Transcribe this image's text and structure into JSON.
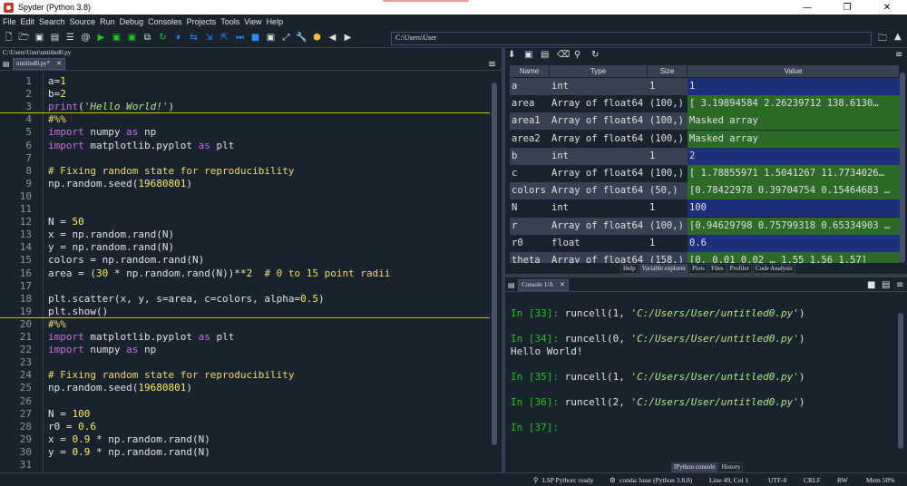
{
  "window": {
    "title": "Spyder (Python 3.8)",
    "min": "—",
    "max": "❐",
    "close": "✕"
  },
  "menu": [
    "File",
    "Edit",
    "Search",
    "Source",
    "Run",
    "Debug",
    "Consoles",
    "Projects",
    "Tools",
    "View",
    "Help"
  ],
  "toolbar": {
    "path": "C:\\Users\\User"
  },
  "editor": {
    "file_path": "C:\\Users\\User\\untitled0.py",
    "tab_label": "untitled0.py*",
    "lines": [
      {
        "n": "1",
        "html": "a=<span class=\"num\">1</span>"
      },
      {
        "n": "2",
        "html": "b=<span class=\"num\">2</span>"
      },
      {
        "n": "3",
        "html": "<span class=\"kw\">print</span>(<span class=\"str\">'Hello World!'</span>)",
        "sep": true
      },
      {
        "n": "4",
        "html": "<span class=\"cmt\">#%%</span>"
      },
      {
        "n": "5",
        "html": "<span class=\"kw\">import</span> numpy <span class=\"kw\">as</span> np"
      },
      {
        "n": "6",
        "html": "<span class=\"kw\">import</span> matplotlib.pyplot <span class=\"kw\">as</span> plt"
      },
      {
        "n": "7",
        "html": ""
      },
      {
        "n": "8",
        "html": "<span class=\"cmt\"># Fixing random state for reproducibility</span>"
      },
      {
        "n": "9",
        "html": "np.random.seed(<span class=\"num\">19680801</span>)"
      },
      {
        "n": "10",
        "html": ""
      },
      {
        "n": "11",
        "html": ""
      },
      {
        "n": "12",
        "html": "N = <span class=\"num\">50</span>"
      },
      {
        "n": "13",
        "html": "x = np.random.rand(N)"
      },
      {
        "n": "14",
        "html": "y = np.random.rand(N)"
      },
      {
        "n": "15",
        "html": "colors = np.random.rand(N)"
      },
      {
        "n": "16",
        "html": "area = (<span class=\"num\">30</span> * np.random.rand(N))**<span class=\"num\">2</span>  <span class=\"cmt\"># 0 to 15 point radii</span>"
      },
      {
        "n": "17",
        "html": ""
      },
      {
        "n": "18",
        "html": "plt.scatter(x, y, s=area, c=colors, alpha=<span class=\"num\">0.5</span>)"
      },
      {
        "n": "19",
        "html": "plt.show()",
        "sep": true
      },
      {
        "n": "20",
        "html": "<span class=\"cmt\">#%%</span>"
      },
      {
        "n": "21",
        "html": "<span class=\"kw\">import</span> matplotlib.pyplot <span class=\"kw\">as</span> plt"
      },
      {
        "n": "22",
        "html": "<span class=\"kw\">import</span> numpy <span class=\"kw\">as</span> np"
      },
      {
        "n": "23",
        "html": ""
      },
      {
        "n": "24",
        "html": "<span class=\"cmt\"># Fixing random state for reproducibility</span>"
      },
      {
        "n": "25",
        "html": "np.random.seed(<span class=\"num\">19680801</span>)"
      },
      {
        "n": "26",
        "html": ""
      },
      {
        "n": "27",
        "html": "N = <span class=\"num\">100</span>"
      },
      {
        "n": "28",
        "html": "r0 = <span class=\"num\">0.6</span>"
      },
      {
        "n": "29",
        "html": "x = <span class=\"num\">0.9</span> * np.random.rand(N)"
      },
      {
        "n": "30",
        "html": "y = <span class=\"num\">0.9</span> * np.random.rand(N)"
      },
      {
        "n": "31",
        "html": ""
      }
    ]
  },
  "variable_explorer": {
    "headers": [
      "Name",
      "Type",
      "Size",
      "Value"
    ],
    "rows": [
      {
        "name": "a",
        "type": "int",
        "size": "1",
        "value": "1",
        "color": "blue"
      },
      {
        "name": "area",
        "type": "Array of float64",
        "size": "(100,)",
        "value": "[  3.19894584   2.26239712 138.6130…",
        "color": "green"
      },
      {
        "name": "area1",
        "type": "Array of float64",
        "size": "(100,)",
        "value": "Masked array",
        "color": "green"
      },
      {
        "name": "area2",
        "type": "Array of float64",
        "size": "(100,)",
        "value": "Masked array",
        "color": "green"
      },
      {
        "name": "b",
        "type": "int",
        "size": "1",
        "value": "2",
        "color": "blue"
      },
      {
        "name": "c",
        "type": "Array of float64",
        "size": "(100,)",
        "value": "[ 1.78855971  1.5041267  11.7734026…",
        "color": "green"
      },
      {
        "name": "colors",
        "type": "Array of float64",
        "size": "(50,)",
        "value": "[0.78422978 0.39704754 0.15464683 …",
        "color": "green"
      },
      {
        "name": "N",
        "type": "int",
        "size": "1",
        "value": "100",
        "color": "blue"
      },
      {
        "name": "r",
        "type": "Array of float64",
        "size": "(100,)",
        "value": "[0.94629798 0.75799318 0.65334903 …",
        "color": "green"
      },
      {
        "name": "r0",
        "type": "float",
        "size": "1",
        "value": "0.6",
        "color": "blue"
      },
      {
        "name": "theta",
        "type": "Array of float64",
        "size": "(158,)",
        "value": "[0.   0.01 0.02 …  1.55 1.56 1.57]",
        "color": "green"
      }
    ],
    "tabs": [
      "Help",
      "Variable explorer",
      "Plots",
      "Files",
      "Profiler",
      "Code Analysis"
    ]
  },
  "console": {
    "tab_label": "Console 1/A",
    "lines": [
      {
        "prompt": "In [33]: ",
        "pre": "runcell(1, ",
        "str": "'C:/Users/User/untitled0.py'",
        "post": ")"
      },
      {
        "prompt": "In [34]: ",
        "pre": "runcell(0, ",
        "str": "'C:/Users/User/untitled0.py'",
        "post": ")"
      },
      {
        "prompt": "",
        "pre": "Hello World!",
        "str": "",
        "post": ""
      },
      {
        "prompt": "In [35]: ",
        "pre": "runcell(1, ",
        "str": "'C:/Users/User/untitled0.py'",
        "post": ")"
      },
      {
        "prompt": "In [36]: ",
        "pre": "runcell(2, ",
        "str": "'C:/Users/User/untitled0.py'",
        "post": ")"
      },
      {
        "prompt": "In [37]: ",
        "pre": "",
        "str": "",
        "post": ""
      }
    ],
    "bottom_tabs": [
      "IPython console",
      "History"
    ]
  },
  "status": {
    "lsp": "LSP Python: ready",
    "conda": "conda: base (Python 3.8.8)",
    "position": "Line 49, Col 1",
    "encoding": "UTF-8",
    "eol": "CRLF",
    "rw": "RW",
    "mem": "Mem 58%"
  }
}
